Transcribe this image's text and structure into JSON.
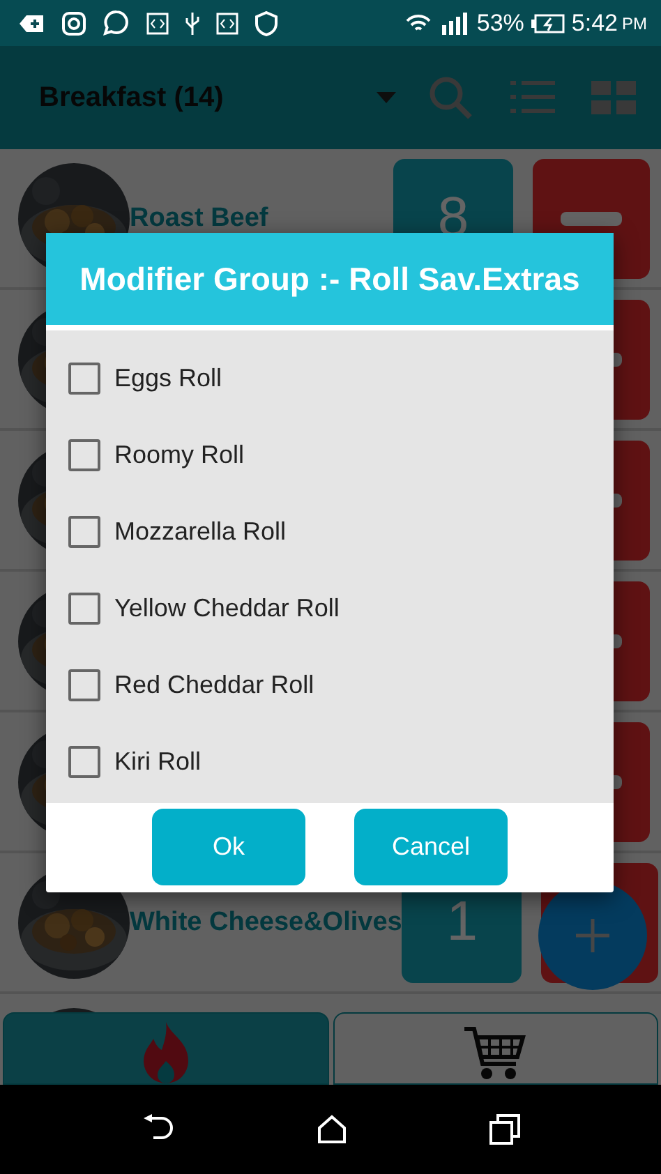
{
  "status_bar": {
    "battery": "53%",
    "time": "5:42",
    "time_suffix": "PM"
  },
  "app_bar": {
    "title": "Breakfast (14)"
  },
  "items": [
    {
      "name": "Roast Beef",
      "count": "8",
      "kind": "minus"
    },
    {
      "kind": "minus"
    },
    {
      "kind": "minus"
    },
    {
      "kind": "minus"
    },
    {
      "kind": "minus"
    },
    {
      "name": "White Cheese&Olives",
      "count": "1",
      "kind": "plus"
    },
    {
      "kind": "empty"
    }
  ],
  "bottom_tabs": [
    {
      "kind": "fire",
      "selected": true
    },
    {
      "kind": "cart",
      "selected": false
    }
  ],
  "dialog": {
    "title": "Modifier Group :- Roll Sav.Extras",
    "options": [
      {
        "label": "Eggs Roll",
        "checked": false
      },
      {
        "label": "Roomy Roll",
        "checked": false
      },
      {
        "label": "Mozzarella Roll",
        "checked": false
      },
      {
        "label": "Yellow Cheddar Roll",
        "checked": false
      },
      {
        "label": "Red Cheddar Roll",
        "checked": false
      },
      {
        "label": "Kiri Roll",
        "checked": false
      }
    ],
    "buttons": [
      "Ok",
      "Cancel"
    ]
  }
}
